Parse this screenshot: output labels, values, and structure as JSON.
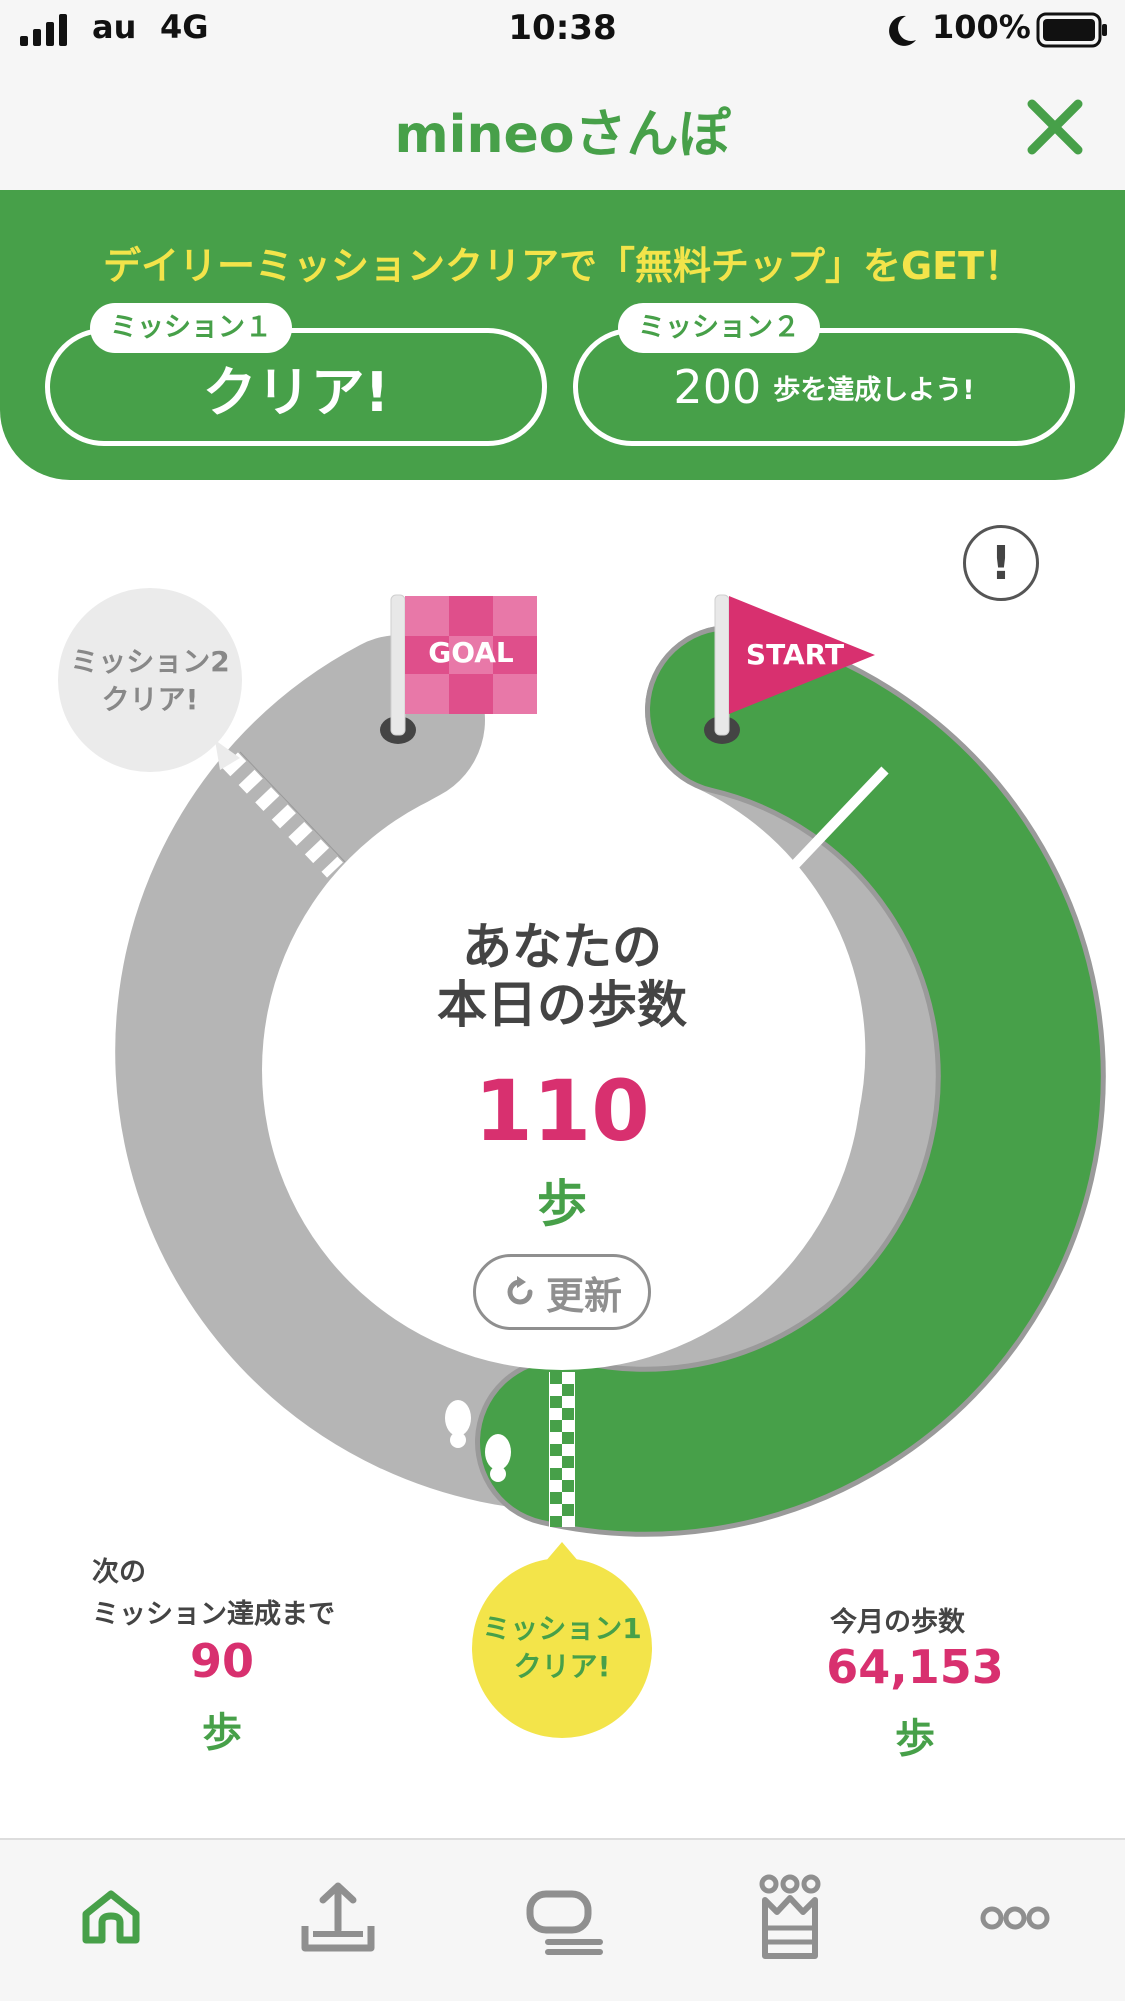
{
  "status_bar": {
    "carrier": "au",
    "network": "4G",
    "time": "10:38",
    "battery": "100%",
    "icons": [
      "signal-icon",
      "moon-icon",
      "battery-icon"
    ]
  },
  "nav": {
    "title": "mineoさんぽ",
    "close_icon": "close-icon"
  },
  "banner": {
    "text": "デイリーミッションクリアで「無料チップ」をGET！",
    "missions": [
      {
        "tag": "ミッション１",
        "status": "クリア!"
      },
      {
        "tag": "ミッション２",
        "value": "200",
        "suffix": "歩を達成しよう!"
      }
    ]
  },
  "course": {
    "goal_flag": "GOAL",
    "start_flag": "START",
    "mission2_bubble": [
      "ミッション2",
      "クリア!"
    ],
    "mission1_bubble": [
      "ミッション1",
      "クリア!"
    ],
    "heading_line1": "あなたの",
    "heading_line2": "本日の歩数",
    "today_steps": "110",
    "unit": "歩",
    "refresh_label": "更新",
    "progress_icon": "footprints-icon"
  },
  "stats": {
    "next_label_line1": "次の",
    "next_label_line2": "ミッション達成まで",
    "next_value": "90",
    "next_unit": "歩",
    "month_label": "今月の歩数",
    "month_value": "64,153",
    "month_unit": "歩"
  },
  "tabbar": {
    "tabs": [
      "home-icon",
      "upload-icon",
      "chat-icon",
      "ranking-crown-icon",
      "more-icon"
    ],
    "active": "home-icon"
  },
  "colors": {
    "green": "#47a049",
    "pink": "#d8306f",
    "yellow": "#f3e44a",
    "gray": "#b5b5b5"
  }
}
